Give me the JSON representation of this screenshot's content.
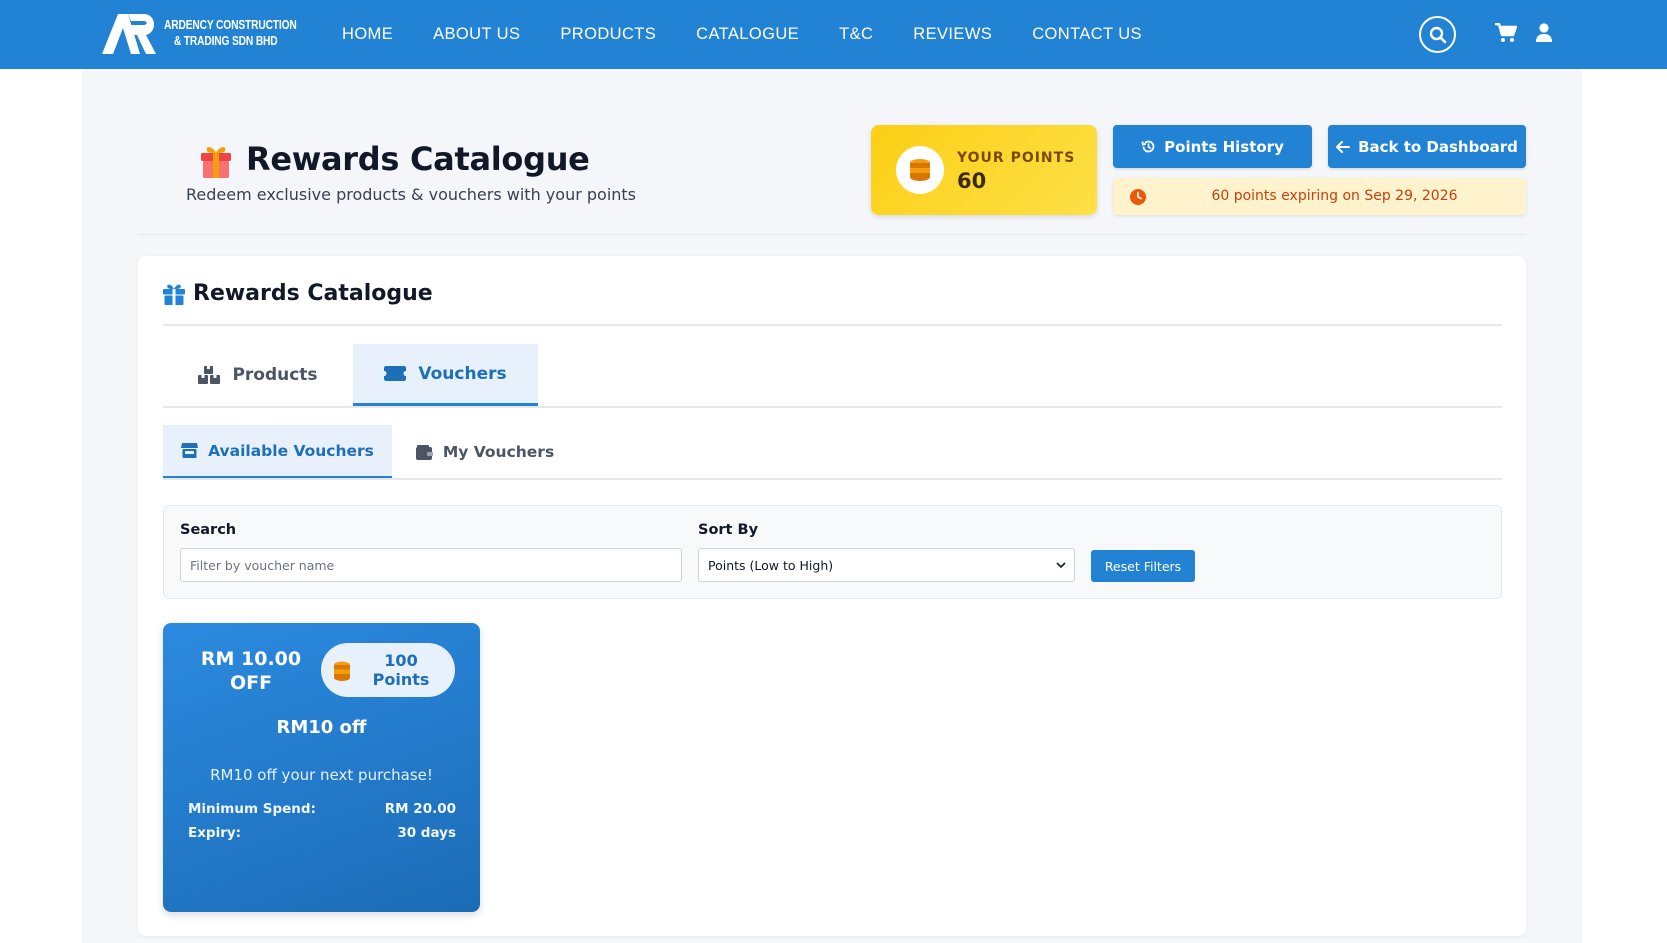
{
  "navbar": {
    "brand_line1": "ARDENCY CONSTRUCTION",
    "brand_line2": "& TRADING SDN BHD",
    "links": [
      "HOME",
      "ABOUT US",
      "PRODUCTS",
      "CATALOGUE",
      "T&C",
      "REVIEWS",
      "CONTACT US"
    ],
    "icons": [
      "search-icon",
      "cart-icon",
      "user-icon"
    ],
    "bg_color": "#2283d4"
  },
  "header": {
    "title": "Rewards Catalogue",
    "subtitle": "Redeem exclusive products & vouchers with your points",
    "points_label": "YOUR POINTS",
    "points_value": "60",
    "history_button": "Points History",
    "dashboard_button": "Back to Dashboard",
    "expiry_notice": "60 points expiring on Sep 29, 2026"
  },
  "catalogue": {
    "title": "Rewards Catalogue",
    "tabs": [
      {
        "label": "Products",
        "active": false
      },
      {
        "label": "Vouchers",
        "active": true
      }
    ],
    "subtabs": [
      {
        "label": "Available Vouchers",
        "active": true
      },
      {
        "label": "My Vouchers",
        "active": false
      }
    ],
    "filters": {
      "search_label": "Search",
      "search_placeholder": "Filter by voucher name",
      "sort_label": "Sort By",
      "sort_selected": "Points (Low to High)",
      "reset_label": "Reset Filters"
    },
    "vouchers": [
      {
        "amount_line1": "RM 10.00",
        "amount_line2": "OFF",
        "points_line1": "100",
        "points_line2": "Points",
        "name": "RM10 off",
        "description": "RM10 off your next purchase!",
        "min_spend_label": "Minimum Spend:",
        "min_spend_value": "RM 20.00",
        "expiry_label": "Expiry:",
        "expiry_value": "30 days"
      }
    ]
  },
  "colors": {
    "primary": "#2283d4",
    "points_yellow": "#fbcf14",
    "expiry_bg": "#fff3cd",
    "expiry_text": "#c2410c"
  }
}
